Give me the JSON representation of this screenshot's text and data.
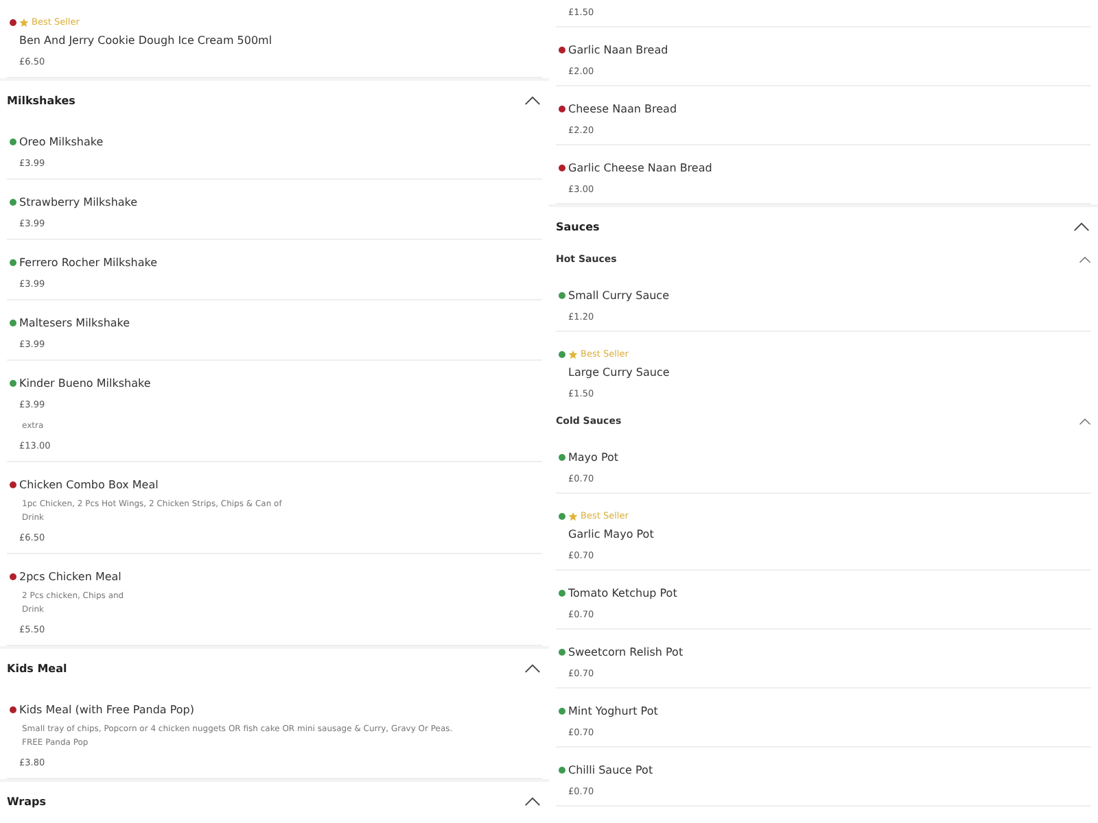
{
  "columns": [
    {
      "blocks": [
        {
          "kind": "item",
          "color": "#b0202c",
          "best_seller": true,
          "badge": "Best Seller",
          "name": "Ben And Jerry Cookie Dough Ice Cream 500ml",
          "price": "£6.50",
          "divider": true
        },
        {
          "kind": "section",
          "title": "Milkshakes",
          "expanded": true
        },
        {
          "kind": "item",
          "color": "#3f9b4f",
          "best_seller": false,
          "name": "Oreo Milkshake",
          "price": "£3.99",
          "divider": true
        },
        {
          "kind": "item",
          "color": "#3f9b4f",
          "best_seller": false,
          "name": "Strawberry Milkshake",
          "price": "£3.99",
          "divider": true
        },
        {
          "kind": "item",
          "color": "#3f9b4f",
          "best_seller": false,
          "name": "Ferrero Rocher Milkshake",
          "price": "£3.99",
          "divider": true
        },
        {
          "kind": "item",
          "color": "#3f9b4f",
          "best_seller": false,
          "name": "Maltesers Milkshake",
          "price": "£3.99",
          "divider": true
        },
        {
          "kind": "item",
          "color": "#3f9b4f",
          "best_seller": false,
          "name": "Kinder Bueno Milkshake",
          "price": "£3.99",
          "divider": false
        },
        {
          "kind": "fragment",
          "description": [
            "extra"
          ],
          "price": "£13.00"
        },
        {
          "kind": "item",
          "color": "#b0202c",
          "best_seller": false,
          "name": "Chicken Combo Box Meal",
          "description": [
            "1pc Chicken, 2 Pcs Hot Wings, 2 Chicken Strips, Chips & Can of",
            "Drink"
          ],
          "price": "£6.50",
          "divider": true
        },
        {
          "kind": "item",
          "color": "#b0202c",
          "best_seller": false,
          "name": "2pcs Chicken Meal",
          "description": [
            "2 Pcs chicken, Chips and",
            "Drink"
          ],
          "price": "£5.50",
          "divider": true
        },
        {
          "kind": "section",
          "title": "Kids Meal",
          "expanded": true
        },
        {
          "kind": "item",
          "color": "#b0202c",
          "best_seller": false,
          "name": "Kids Meal (with Free Panda Pop)",
          "description": [
            "Small tray of chips, Popcorn or 4 chicken nuggets OR fish cake OR mini sausage & Curry, Gravy Or Peas.",
            "FREE Panda Pop"
          ],
          "price": "£3.80",
          "divider": true
        },
        {
          "kind": "section",
          "title": "Wraps",
          "expanded": true
        }
      ]
    },
    {
      "blocks": [
        {
          "kind": "fragment",
          "price": "£1.50"
        },
        {
          "kind": "item",
          "color": "#b0202c",
          "best_seller": false,
          "name": "Garlic Naan Bread",
          "price": "£2.00",
          "divider": true
        },
        {
          "kind": "item",
          "color": "#b0202c",
          "best_seller": false,
          "name": "Cheese Naan Bread",
          "price": "£2.20",
          "divider": true
        },
        {
          "kind": "item",
          "color": "#b0202c",
          "best_seller": false,
          "name": "Garlic Cheese Naan Bread",
          "price": "£3.00",
          "divider": true
        },
        {
          "kind": "section",
          "title": "Sauces",
          "expanded": true
        },
        {
          "kind": "subsection",
          "title": "Hot Sauces",
          "expanded": true
        },
        {
          "kind": "item",
          "color": "#3f9b4f",
          "best_seller": false,
          "name": "Small Curry Sauce",
          "price": "£1.20",
          "divider": true
        },
        {
          "kind": "item",
          "color": "#3f9b4f",
          "best_seller": true,
          "badge": "Best Seller",
          "name": "Large Curry Sauce",
          "price": "£1.50",
          "divider": false
        },
        {
          "kind": "subsection",
          "title": "Cold Sauces",
          "expanded": true
        },
        {
          "kind": "item",
          "color": "#3f9b4f",
          "best_seller": false,
          "name": "Mayo Pot",
          "price": "£0.70",
          "divider": true
        },
        {
          "kind": "item",
          "color": "#3f9b4f",
          "best_seller": true,
          "badge": "Best Seller",
          "name": "Garlic Mayo Pot",
          "price": "£0.70",
          "divider": true
        },
        {
          "kind": "item",
          "color": "#3f9b4f",
          "best_seller": false,
          "name": "Tomato Ketchup Pot",
          "price": "£0.70",
          "divider": true
        },
        {
          "kind": "item",
          "color": "#3f9b4f",
          "best_seller": false,
          "name": "Sweetcorn Relish Pot",
          "price": "£0.70",
          "divider": true
        },
        {
          "kind": "item",
          "color": "#3f9b4f",
          "best_seller": false,
          "name": "Mint Yoghurt Pot",
          "price": "£0.70",
          "divider": true
        },
        {
          "kind": "item",
          "color": "#3f9b4f",
          "best_seller": false,
          "name": "Chilli Sauce Pot",
          "price": "£0.70",
          "divider": true
        }
      ]
    }
  ]
}
